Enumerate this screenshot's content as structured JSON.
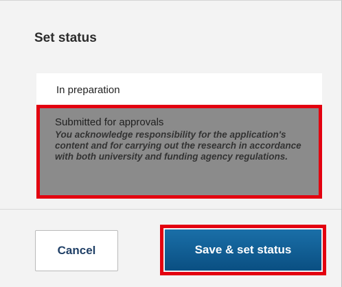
{
  "dialog": {
    "title": "Set status",
    "options": [
      {
        "label": "In preparation",
        "selected": false
      },
      {
        "label": "Submitted for approvals",
        "description": "You acknowledge responsibility for the application's content and for carrying out the research in accordance with both university and funding agency regulations.",
        "selected": true
      }
    ],
    "cancel_label": "Cancel",
    "save_label": "Save & set status"
  },
  "colors": {
    "highlight": "#e3000f",
    "primary_button": "#0a4f82",
    "selected_option_bg": "#8b8b8b"
  }
}
